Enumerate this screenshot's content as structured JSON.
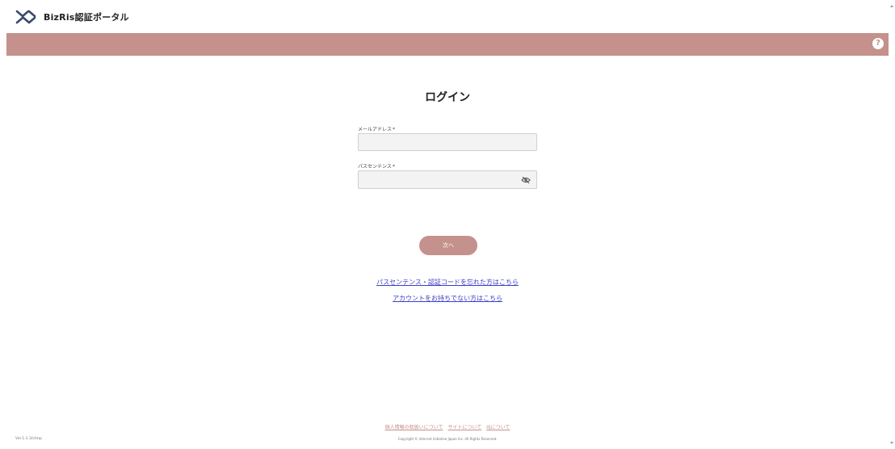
{
  "header": {
    "app_title": "BizRis認証ポータル",
    "help_icon": "question-circle-icon",
    "help_symbol": "?",
    "band_color": "#c4918c"
  },
  "login": {
    "title": "ログイン",
    "email": {
      "label": "メールアドレス",
      "required_mark": "*",
      "value": "",
      "placeholder": ""
    },
    "password": {
      "label": "パスセンテンス",
      "required_mark": "*",
      "value": "",
      "placeholder": "",
      "toggle_icon": "eye-off-icon"
    },
    "next_label": "次へ",
    "forgot_link": "パスセンテンス・認証コードを忘れた方はこちら",
    "no_account_link": "アカウントをお持ちでない方はこちら"
  },
  "footer": {
    "links": [
      "個人情報の取扱いについて",
      "サイトについて",
      "IIJについて"
    ],
    "copyright": "Copyright © Internet Initiative Japan Inc. All Rights Reserved.",
    "version": "Ver.1.1.3/ctmp"
  },
  "colors": {
    "accent": "#c4918c",
    "link": "#3b3fc4"
  }
}
